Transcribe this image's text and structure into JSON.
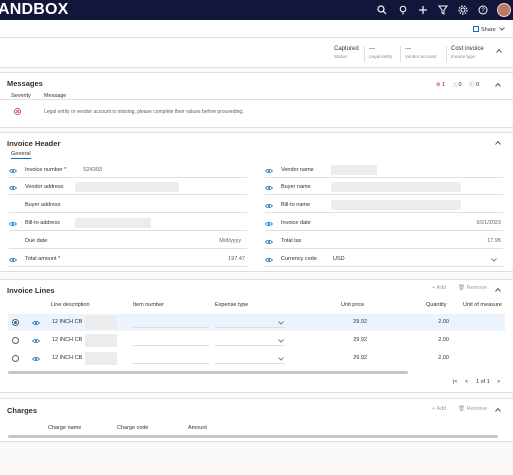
{
  "app": {
    "brand": "ANDBOX"
  },
  "header_icons": [
    "search-icon",
    "lightbulb-icon",
    "plus-icon",
    "filter-icon",
    "settings-icon",
    "help-icon"
  ],
  "actions": {
    "share_label": "Share"
  },
  "status": {
    "status_value": "Captured",
    "status_label": "Status",
    "legal_value": "---",
    "legal_label": "Legal entity",
    "vendor_value": "---",
    "vendor_label": "Vendor account",
    "type_value": "Cost invoice",
    "type_label": "Invoice type"
  },
  "messages": {
    "title": "Messages",
    "error_count": "1",
    "warning_count": "0",
    "info_count": "0",
    "col_severity": "Severity",
    "col_message": "Message",
    "row_text": "Legal entity or vendor account is missing, please complete their values before proceeding."
  },
  "invoice_header": {
    "title": "Invoice Header",
    "tab": "General",
    "invoice_number_label": "Invoice number *",
    "invoice_number_value": "S24393",
    "vendor_address_label": "Vendor address",
    "buyer_address_label": "Buyer address",
    "bill_to_address_label": "Bill-to address",
    "due_date_label": "Due date",
    "due_date_value": "M/d/yyyy",
    "total_amount_label": "Total amount *",
    "total_amount_value": "197.47",
    "vendor_name_label": "Vendor name",
    "buyer_name_label": "Buyer name",
    "bill_to_name_label": "Bill-to name",
    "invoice_date_label": "Invoice date",
    "invoice_date_value": "9/21/2023",
    "total_tax_label": "Total tax",
    "total_tax_value": "17.95",
    "currency_label": "Currency code",
    "currency_value": "USD"
  },
  "invoice_lines": {
    "title": "Invoice Lines",
    "add_label": "Add",
    "remove_label": "Remove",
    "columns": [
      "Line description",
      "Item number",
      "Expense type",
      "Unit price",
      "Quantity",
      "Unit of measure"
    ],
    "rows": [
      {
        "desc": "12 INCH CB",
        "price": "29.92",
        "qty": "2.00",
        "selected": true
      },
      {
        "desc": "12 INCH CB",
        "price": "29.92",
        "qty": "2.00",
        "selected": false
      },
      {
        "desc": "12 INCH CB",
        "price": "29.92",
        "qty": "2.00",
        "selected": false
      }
    ],
    "page_text": "1 of 1"
  },
  "charges": {
    "title": "Charges",
    "add_label": "Add",
    "remove_label": "Remove",
    "columns": [
      "Charge name",
      "Charge code",
      "Amount"
    ]
  },
  "colors": {
    "topbar": "#11163a",
    "accent": "#0f6cbd",
    "error": "#d13438",
    "warning": "#c19c00"
  }
}
